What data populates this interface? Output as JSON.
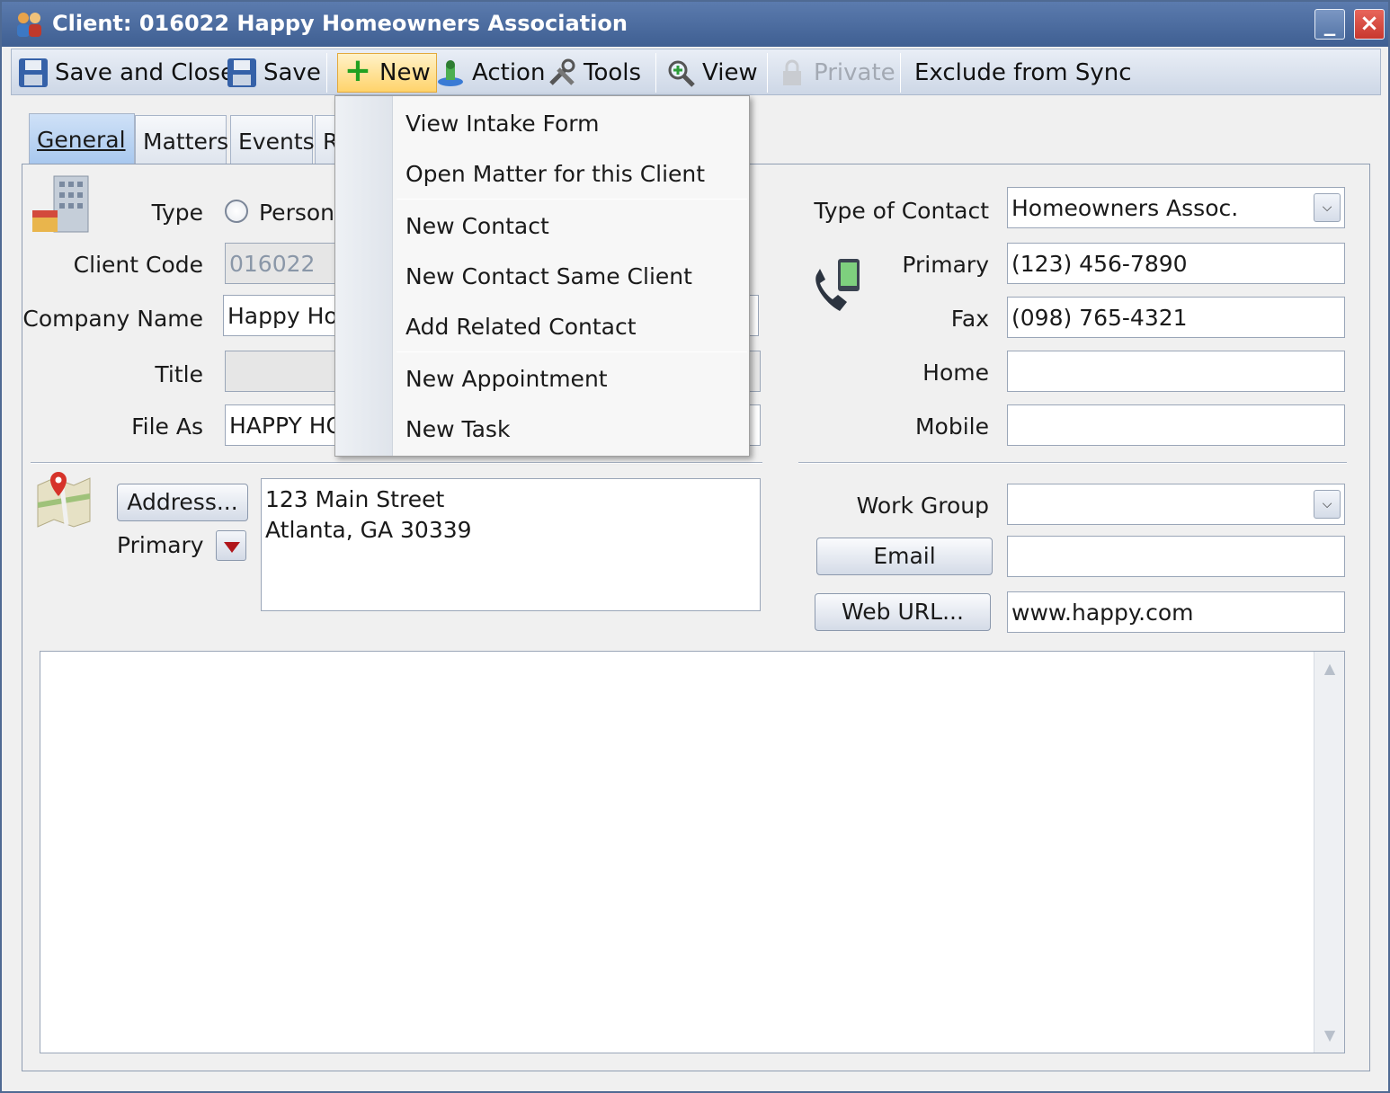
{
  "window": {
    "title": "Client: 016022 Happy Homeowners Association"
  },
  "toolbar": {
    "save_close": "Save and Close",
    "save": "Save",
    "new": "New",
    "action": "Action",
    "tools": "Tools",
    "view": "View",
    "private": "Private",
    "exclude_sync": "Exclude from Sync"
  },
  "tabs": [
    "General",
    "Matters",
    "Events",
    "R"
  ],
  "general": {
    "type_label": "Type",
    "type_person": "Person",
    "client_code_label": "Client Code",
    "client_code": "016022",
    "company_name_label": "Company Name",
    "company_name": "Happy Ho",
    "title_label": "Title",
    "title_value": "",
    "file_as_label": "File As",
    "file_as": "HAPPY HO",
    "address_button": "Address...",
    "address_type": "Primary",
    "address_lines": [
      "123 Main Street",
      "Atlanta, GA 30339"
    ]
  },
  "contact": {
    "type_label": "Type of Contact",
    "type_value": "Homeowners Assoc.",
    "primary_label": "Primary",
    "primary": "(123) 456-7890",
    "fax_label": "Fax",
    "fax": "(098) 765-4321",
    "home_label": "Home",
    "home": "",
    "mobile_label": "Mobile",
    "mobile": "",
    "work_group_label": "Work Group",
    "work_group": "",
    "email_button": "Email",
    "email": "",
    "web_button": "Web URL...",
    "web": "www.happy.com"
  },
  "new_menu": {
    "items": [
      "View Intake Form",
      "Open Matter for this Client",
      "New Contact",
      "New Contact Same Client",
      "Add Related Contact",
      "New Appointment",
      "New Task"
    ]
  },
  "colors": {
    "title_bar": "#4a6a9e",
    "active_button": "#ffd36b",
    "tab_selected": "#b6d0f1"
  }
}
